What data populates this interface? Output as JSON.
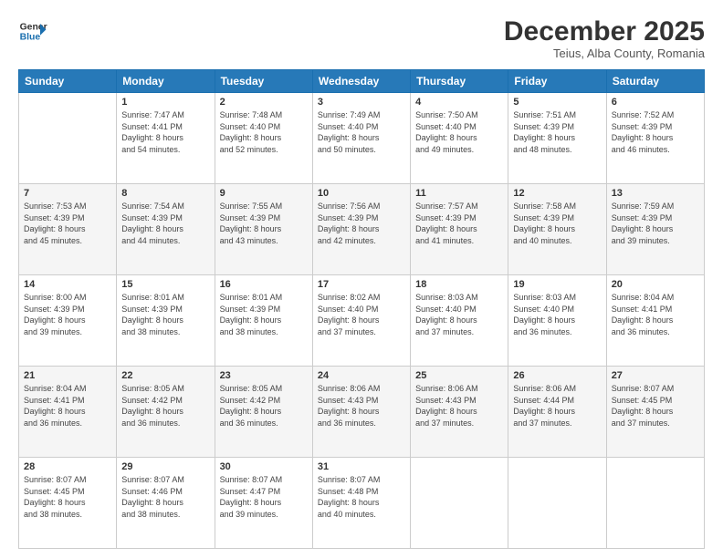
{
  "logo": {
    "line1": "General",
    "line2": "Blue"
  },
  "header": {
    "month": "December 2025",
    "location": "Teius, Alba County, Romania"
  },
  "days": [
    "Sunday",
    "Monday",
    "Tuesday",
    "Wednesday",
    "Thursday",
    "Friday",
    "Saturday"
  ],
  "weeks": [
    [
      {
        "date": "",
        "info": ""
      },
      {
        "date": "1",
        "info": "Sunrise: 7:47 AM\nSunset: 4:41 PM\nDaylight: 8 hours\nand 54 minutes."
      },
      {
        "date": "2",
        "info": "Sunrise: 7:48 AM\nSunset: 4:40 PM\nDaylight: 8 hours\nand 52 minutes."
      },
      {
        "date": "3",
        "info": "Sunrise: 7:49 AM\nSunset: 4:40 PM\nDaylight: 8 hours\nand 50 minutes."
      },
      {
        "date": "4",
        "info": "Sunrise: 7:50 AM\nSunset: 4:40 PM\nDaylight: 8 hours\nand 49 minutes."
      },
      {
        "date": "5",
        "info": "Sunrise: 7:51 AM\nSunset: 4:39 PM\nDaylight: 8 hours\nand 48 minutes."
      },
      {
        "date": "6",
        "info": "Sunrise: 7:52 AM\nSunset: 4:39 PM\nDaylight: 8 hours\nand 46 minutes."
      }
    ],
    [
      {
        "date": "7",
        "info": "Sunrise: 7:53 AM\nSunset: 4:39 PM\nDaylight: 8 hours\nand 45 minutes."
      },
      {
        "date": "8",
        "info": "Sunrise: 7:54 AM\nSunset: 4:39 PM\nDaylight: 8 hours\nand 44 minutes."
      },
      {
        "date": "9",
        "info": "Sunrise: 7:55 AM\nSunset: 4:39 PM\nDaylight: 8 hours\nand 43 minutes."
      },
      {
        "date": "10",
        "info": "Sunrise: 7:56 AM\nSunset: 4:39 PM\nDaylight: 8 hours\nand 42 minutes."
      },
      {
        "date": "11",
        "info": "Sunrise: 7:57 AM\nSunset: 4:39 PM\nDaylight: 8 hours\nand 41 minutes."
      },
      {
        "date": "12",
        "info": "Sunrise: 7:58 AM\nSunset: 4:39 PM\nDaylight: 8 hours\nand 40 minutes."
      },
      {
        "date": "13",
        "info": "Sunrise: 7:59 AM\nSunset: 4:39 PM\nDaylight: 8 hours\nand 39 minutes."
      }
    ],
    [
      {
        "date": "14",
        "info": "Sunrise: 8:00 AM\nSunset: 4:39 PM\nDaylight: 8 hours\nand 39 minutes."
      },
      {
        "date": "15",
        "info": "Sunrise: 8:01 AM\nSunset: 4:39 PM\nDaylight: 8 hours\nand 38 minutes."
      },
      {
        "date": "16",
        "info": "Sunrise: 8:01 AM\nSunset: 4:39 PM\nDaylight: 8 hours\nand 38 minutes."
      },
      {
        "date": "17",
        "info": "Sunrise: 8:02 AM\nSunset: 4:40 PM\nDaylight: 8 hours\nand 37 minutes."
      },
      {
        "date": "18",
        "info": "Sunrise: 8:03 AM\nSunset: 4:40 PM\nDaylight: 8 hours\nand 37 minutes."
      },
      {
        "date": "19",
        "info": "Sunrise: 8:03 AM\nSunset: 4:40 PM\nDaylight: 8 hours\nand 36 minutes."
      },
      {
        "date": "20",
        "info": "Sunrise: 8:04 AM\nSunset: 4:41 PM\nDaylight: 8 hours\nand 36 minutes."
      }
    ],
    [
      {
        "date": "21",
        "info": "Sunrise: 8:04 AM\nSunset: 4:41 PM\nDaylight: 8 hours\nand 36 minutes."
      },
      {
        "date": "22",
        "info": "Sunrise: 8:05 AM\nSunset: 4:42 PM\nDaylight: 8 hours\nand 36 minutes."
      },
      {
        "date": "23",
        "info": "Sunrise: 8:05 AM\nSunset: 4:42 PM\nDaylight: 8 hours\nand 36 minutes."
      },
      {
        "date": "24",
        "info": "Sunrise: 8:06 AM\nSunset: 4:43 PM\nDaylight: 8 hours\nand 36 minutes."
      },
      {
        "date": "25",
        "info": "Sunrise: 8:06 AM\nSunset: 4:43 PM\nDaylight: 8 hours\nand 37 minutes."
      },
      {
        "date": "26",
        "info": "Sunrise: 8:06 AM\nSunset: 4:44 PM\nDaylight: 8 hours\nand 37 minutes."
      },
      {
        "date": "27",
        "info": "Sunrise: 8:07 AM\nSunset: 4:45 PM\nDaylight: 8 hours\nand 37 minutes."
      }
    ],
    [
      {
        "date": "28",
        "info": "Sunrise: 8:07 AM\nSunset: 4:45 PM\nDaylight: 8 hours\nand 38 minutes."
      },
      {
        "date": "29",
        "info": "Sunrise: 8:07 AM\nSunset: 4:46 PM\nDaylight: 8 hours\nand 38 minutes."
      },
      {
        "date": "30",
        "info": "Sunrise: 8:07 AM\nSunset: 4:47 PM\nDaylight: 8 hours\nand 39 minutes."
      },
      {
        "date": "31",
        "info": "Sunrise: 8:07 AM\nSunset: 4:48 PM\nDaylight: 8 hours\nand 40 minutes."
      },
      {
        "date": "",
        "info": ""
      },
      {
        "date": "",
        "info": ""
      },
      {
        "date": "",
        "info": ""
      }
    ]
  ]
}
